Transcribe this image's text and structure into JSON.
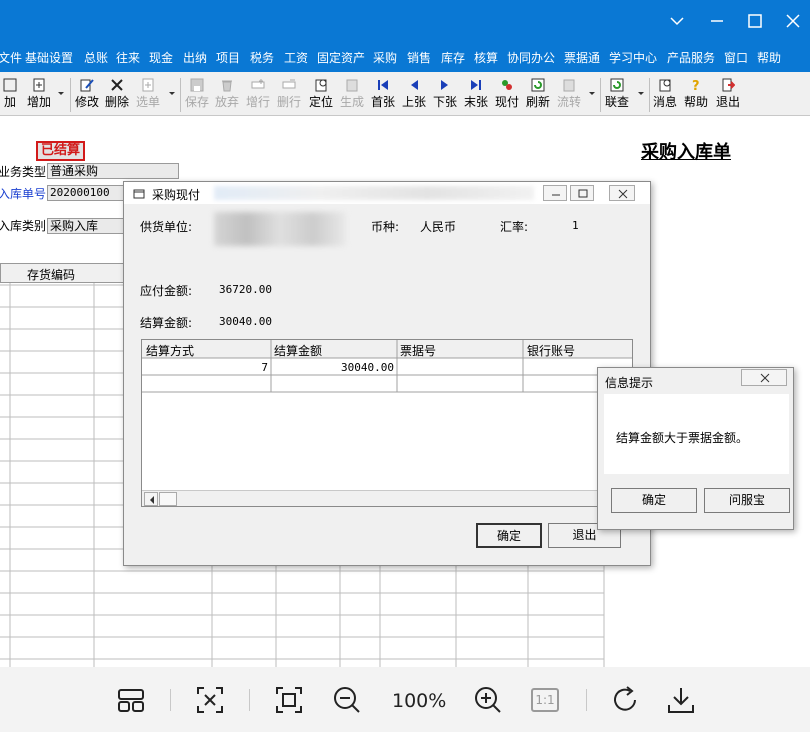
{
  "app": {
    "menu": [
      "文件",
      "基础设置",
      "总账",
      "往来",
      "现金",
      "出纳",
      "项目",
      "税务",
      "工资",
      "固定资产",
      "采购",
      "销售",
      "库存",
      "核算",
      "协同办公",
      "票据通",
      "学习中心",
      "产品服务",
      "窗口",
      "帮助"
    ]
  },
  "toolbar": {
    "buttons": [
      {
        "label": "加",
        "icon": "add-icon"
      },
      {
        "label": "增加",
        "icon": "new-doc-icon"
      },
      {
        "label": "修改",
        "icon": "edit-icon"
      },
      {
        "label": "删除",
        "icon": "delete-icon"
      },
      {
        "label": "选单",
        "icon": "select-doc-icon"
      },
      {
        "label": "保存",
        "icon": "save-icon"
      },
      {
        "label": "放弃",
        "icon": "discard-icon"
      },
      {
        "label": "增行",
        "icon": "add-row-icon"
      },
      {
        "label": "删行",
        "icon": "delete-row-icon"
      },
      {
        "label": "定位",
        "icon": "locate-icon"
      },
      {
        "label": "生成",
        "icon": "generate-icon"
      },
      {
        "label": "首张",
        "icon": "first-icon"
      },
      {
        "label": "上张",
        "icon": "prev-icon"
      },
      {
        "label": "下张",
        "icon": "next-icon"
      },
      {
        "label": "末张",
        "icon": "last-icon"
      },
      {
        "label": "现付",
        "icon": "cash-pay-icon"
      },
      {
        "label": "刷新",
        "icon": "refresh-icon"
      },
      {
        "label": "流转",
        "icon": "flow-icon"
      },
      {
        "label": "联查",
        "icon": "link-query-icon"
      },
      {
        "label": "消息",
        "icon": "message-icon"
      },
      {
        "label": "帮助",
        "icon": "help-icon"
      },
      {
        "label": "退出",
        "icon": "exit-icon"
      }
    ]
  },
  "document": {
    "status_stamp": "已结算",
    "title": "采购入库单",
    "fields": {
      "biz_type_label": "业务类型",
      "biz_type_value": "普通采购",
      "in_no_label": "入库单号",
      "in_no_value": "202000100",
      "in_category_label": "入库类别",
      "in_category_value": "采购入库"
    },
    "grid_header": "存货编码"
  },
  "pay_dialog": {
    "title": "采购现付",
    "supplier_label": "供货单位:",
    "currency_label": "币种:",
    "currency_value": "人民币",
    "rate_label": "汇率:",
    "rate_value": "1",
    "payable_label": "应付金额:",
    "payable_value": "36720.00",
    "settle_label": "结算金额:",
    "settle_value": "30040.00",
    "grid": {
      "columns": [
        "结算方式",
        "结算金额",
        "票据号",
        "银行账号"
      ],
      "rows": [
        [
          "7",
          "30040.00",
          "",
          ""
        ]
      ]
    },
    "ok": "确定",
    "exit": "退出"
  },
  "message_box": {
    "title": "信息提示",
    "text": "结算金额大于票据金额。",
    "ok": "确定",
    "ask": "问服宝"
  },
  "viewer": {
    "zoom": "100%",
    "one_to_one": "1:1"
  },
  "colors": {
    "accent": "#0a78d4",
    "stamp": "#d21a1a"
  }
}
